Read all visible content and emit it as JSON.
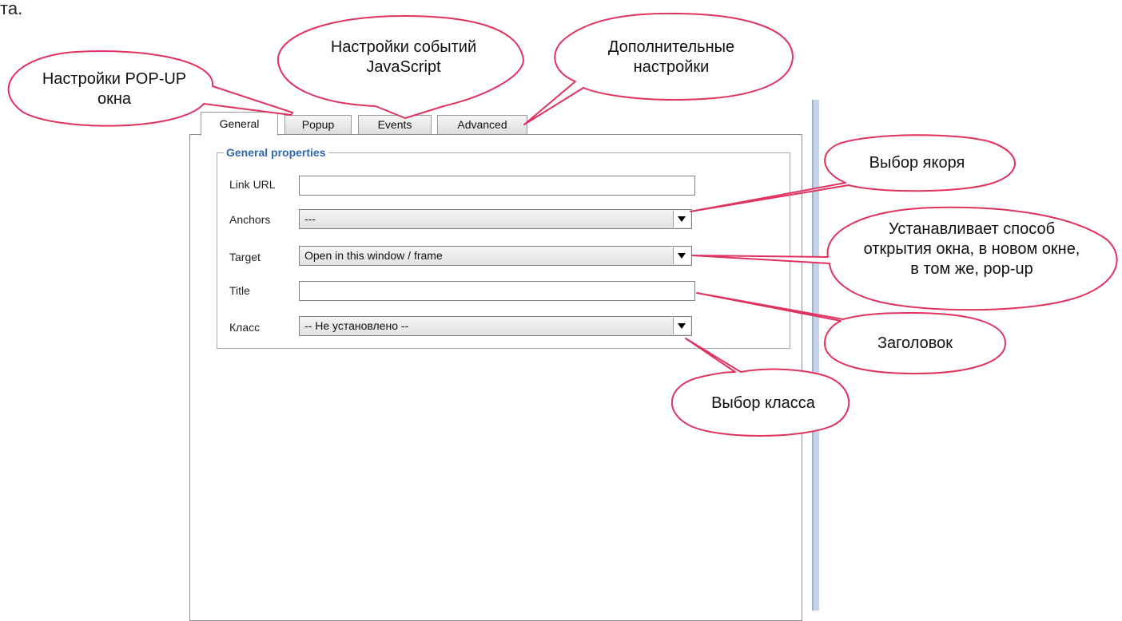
{
  "page_fragment": "та.",
  "tabs": [
    "General",
    "Popup",
    "Events",
    "Advanced"
  ],
  "active_tab": "General",
  "fieldset_legend": "General properties",
  "fields": {
    "link_url": {
      "label": "Link URL",
      "value": ""
    },
    "anchors": {
      "label": "Anchors",
      "value": "---"
    },
    "target": {
      "label": "Target",
      "value": "Open in this window / frame"
    },
    "title": {
      "label": "Title",
      "value": ""
    },
    "class": {
      "label": "Класс",
      "value": "-- Не установлено --"
    }
  },
  "callouts": {
    "popup": [
      "Настройки POP-UP",
      "окна"
    ],
    "events": [
      "Настройки событий",
      "JavaScript"
    ],
    "advanced": [
      "Дополнительные",
      "настройки"
    ],
    "anchor": [
      "Выбор якоря"
    ],
    "target": [
      "Устанавливает способ",
      "открытия окна, в новом окне,",
      "в том же, pop-up"
    ],
    "title": [
      "Заголовок"
    ],
    "class": [
      "Выбор класса"
    ]
  },
  "colors": {
    "callout_stroke": "#e0325f",
    "legend": "#2f67b0",
    "accent_bar": "#c7d3e6"
  }
}
